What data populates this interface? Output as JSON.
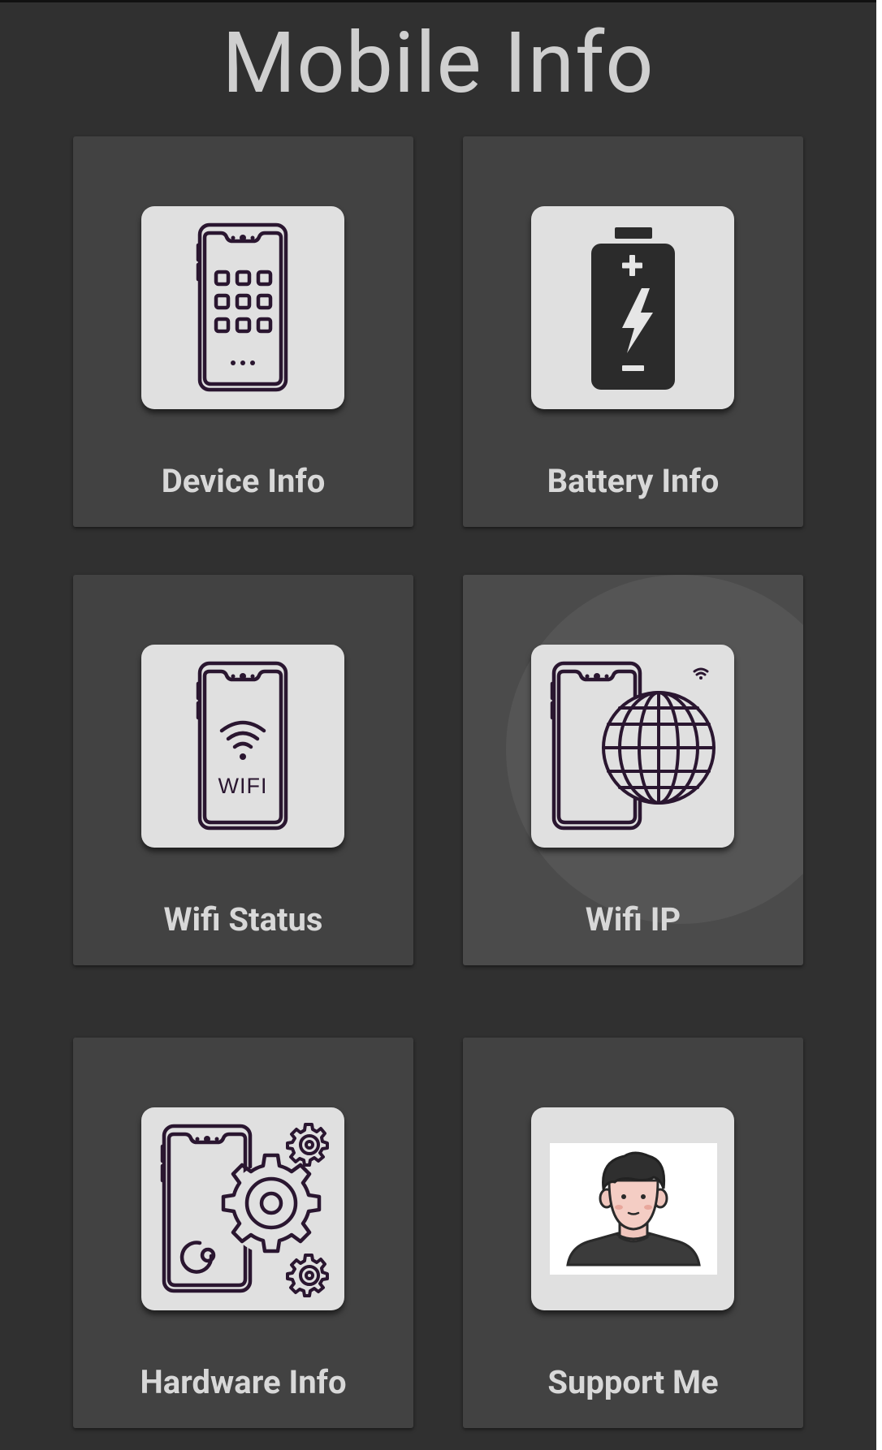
{
  "app": {
    "title": "Mobile Info"
  },
  "cards": [
    {
      "label": "Device Info",
      "icon": "phone-apps-icon"
    },
    {
      "label": "Battery Info",
      "icon": "battery-charging-icon"
    },
    {
      "label": "Wifi Status",
      "icon": "phone-wifi-icon"
    },
    {
      "label": "Wifi IP",
      "icon": "phone-globe-icon"
    },
    {
      "label": "Hardware Info",
      "icon": "phone-gears-icon"
    },
    {
      "label": "Support Me",
      "icon": "user-avatar-icon"
    }
  ],
  "colors": {
    "background": "#303030",
    "card": "#424242",
    "tile": "#e0e0e0",
    "icon_stroke": "#2a1630",
    "label": "#d8d8d8",
    "title": "#cfcfcf"
  }
}
